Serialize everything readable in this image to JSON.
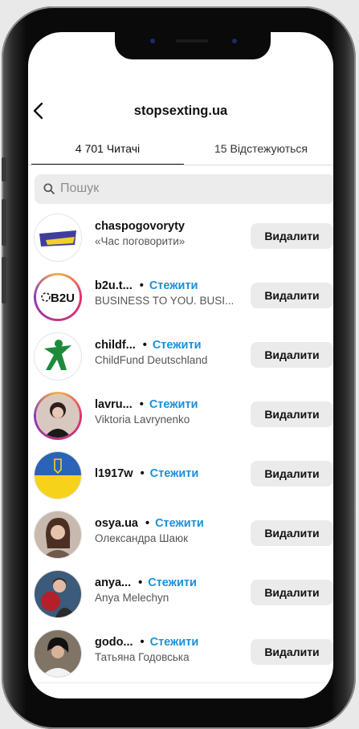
{
  "header": {
    "title": "stopsexting.ua"
  },
  "tabs": [
    {
      "label": "4 701 Читачі",
      "active": true
    },
    {
      "label": "15 Відстежуються",
      "active": false
    }
  ],
  "search": {
    "placeholder": "Пошук"
  },
  "follow_label": "Стежити",
  "remove_label": "Видалити",
  "followers": [
    {
      "username": "chaspogovoryty",
      "name": "«Час поговорити»",
      "show_follow": false,
      "ring": false,
      "avatar": "chas-logo"
    },
    {
      "username": "b2u.t...",
      "name": "BUSINESS TO YOU. BUSI...",
      "show_follow": true,
      "ring": true,
      "avatar": "b2u-logo"
    },
    {
      "username": "childf...",
      "name": "ChildFund Deutschland",
      "show_follow": true,
      "ring": false,
      "avatar": "childfund-logo"
    },
    {
      "username": "lavru...",
      "name": "Viktoria Lavrynenko",
      "show_follow": true,
      "ring": true,
      "avatar": "person-photo"
    },
    {
      "username": "l1917w",
      "name": "",
      "show_follow": true,
      "ring": false,
      "avatar": "ukraine-flag"
    },
    {
      "username": "osya.ua",
      "name": "Олександра Шаюк",
      "show_follow": true,
      "ring": false,
      "avatar": "person-photo"
    },
    {
      "username": "anya...",
      "name": "Anya Melechyn",
      "show_follow": true,
      "ring": false,
      "avatar": "person-photo"
    },
    {
      "username": "godo...",
      "name": "Татьяна Годовська",
      "show_follow": true,
      "ring": false,
      "avatar": "person-photo"
    }
  ],
  "colors": {
    "accent": "#1b8fd9",
    "button_bg": "#ebebeb",
    "search_bg": "#ececec"
  }
}
